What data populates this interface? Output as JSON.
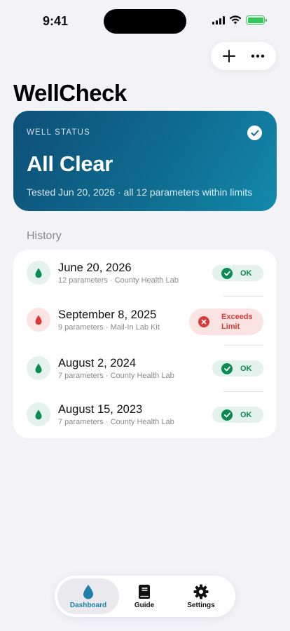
{
  "status_bar": {
    "time": "9:41"
  },
  "header": {
    "add_icon": "plus-icon",
    "more_icon": "ellipsis-icon",
    "title": "WellCheck"
  },
  "well_status": {
    "label": "WELL STATUS",
    "headline": "All Clear",
    "summary": "Tested Jun 20, 2026 · all 12 parameters within limits",
    "colors": {
      "gradient_start": "#0e4f78",
      "gradient_end": "#1289ab"
    }
  },
  "history": {
    "title": "History",
    "items": [
      {
        "date": "June 20, 2026",
        "meta": "12 parameters · County Health Lab",
        "status": "OK",
        "state": "ok"
      },
      {
        "date": "September 8, 2025",
        "meta": "9 parameters · Mail-In Lab Kit",
        "status": "Exceeds Limit",
        "state": "bad"
      },
      {
        "date": "August 2, 2024",
        "meta": "7 parameters · County Health Lab",
        "status": "OK",
        "state": "ok"
      },
      {
        "date": "August 15, 2023",
        "meta": "7 parameters · County Health Lab",
        "status": "OK",
        "state": "ok"
      }
    ]
  },
  "tab_bar": {
    "tabs": [
      {
        "label": "Dashboard",
        "icon": "water-drop-icon",
        "active": true
      },
      {
        "label": "Guide",
        "icon": "book-icon",
        "active": false
      },
      {
        "label": "Settings",
        "icon": "gear-icon",
        "active": false
      }
    ]
  },
  "colors": {
    "ok": "#0b8a52",
    "bad": "#d93a3a",
    "accent": "#1f7fa8"
  }
}
